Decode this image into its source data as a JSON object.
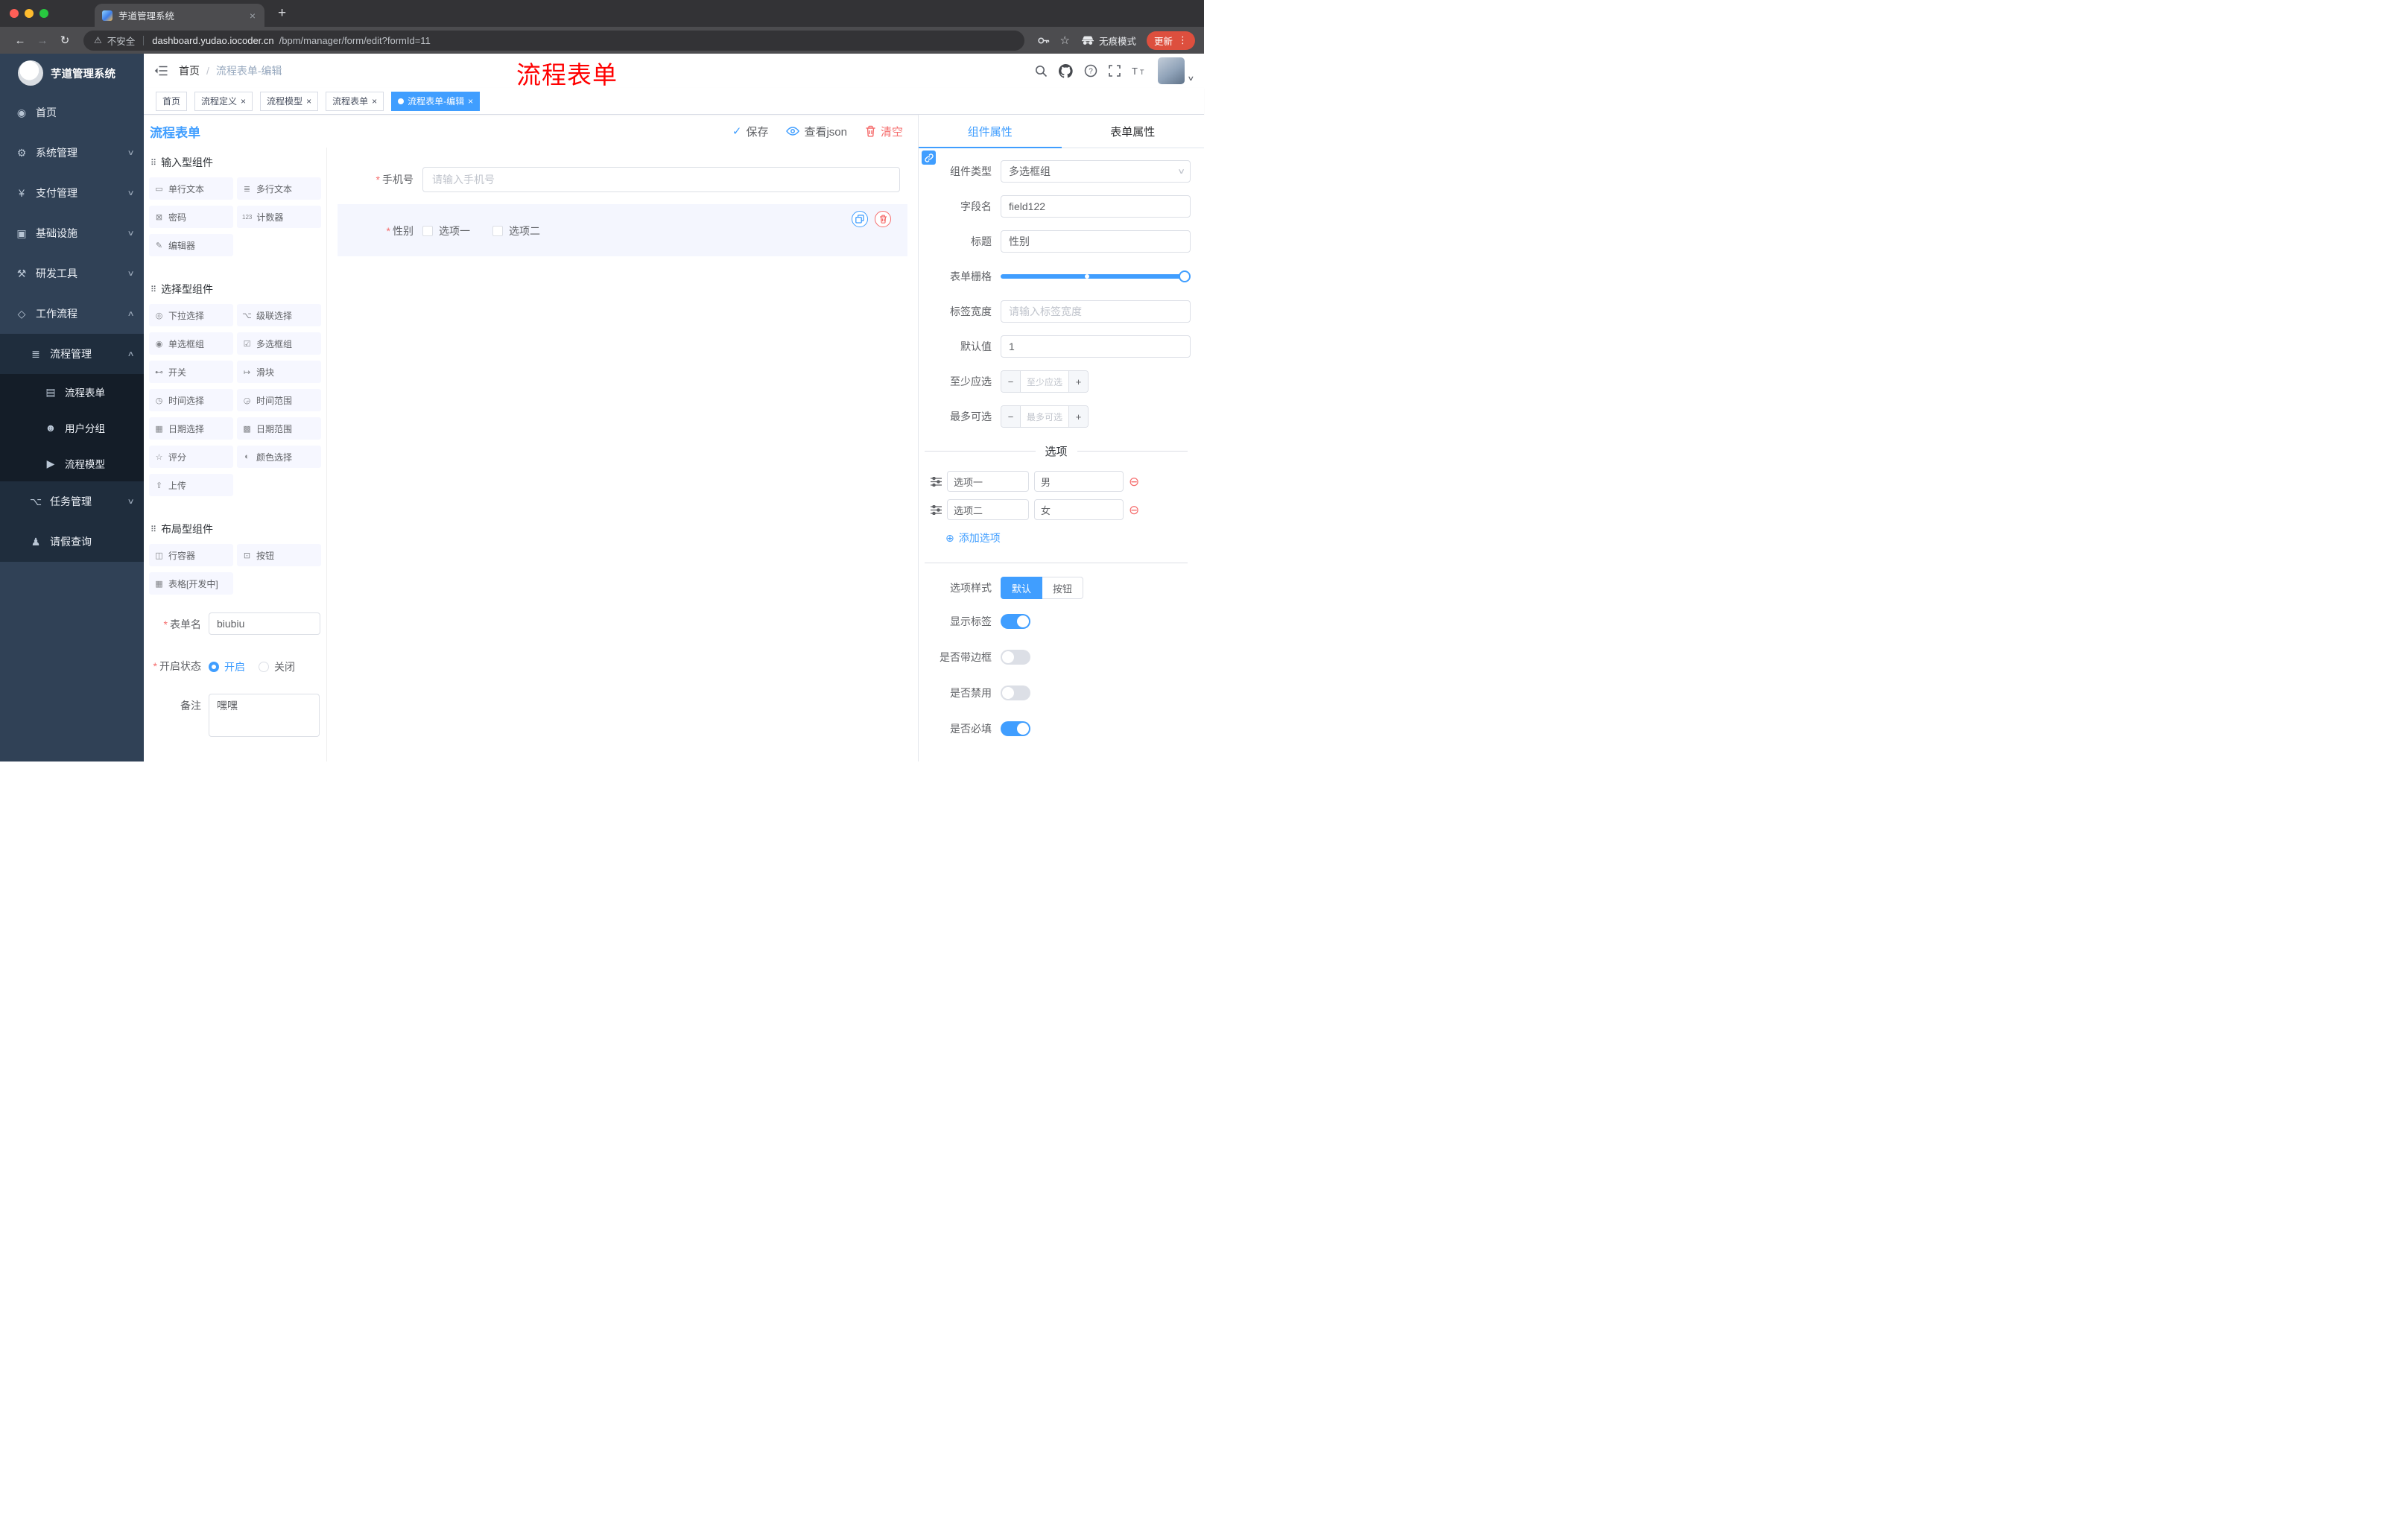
{
  "colors": {
    "accent": "#409EFF",
    "danger": "#F56C6C",
    "sidebar": "#304156"
  },
  "icons": {
    "back": "←",
    "forward": "→",
    "reload": "↻",
    "warning": "⚠",
    "star": "☆",
    "kebab": "⋮",
    "close": "×",
    "new_tab": "+",
    "check": "✓",
    "caret_down": "∨",
    "caret_up": "∧",
    "select_caret": "∨",
    "minus": "−",
    "plus": "+",
    "add_circle": "⊕",
    "remove_circle": "⊖",
    "section_drag": "⠿",
    "slash": "/",
    "required_mark": "*"
  },
  "browser": {
    "tab_title": "芋道管理系统",
    "security_label": "不安全",
    "url_domain": "dashboard.yudao.iocoder.cn",
    "url_path": "/bpm/manager/form/edit?formId=11",
    "incognito_label": "无痕模式",
    "update_label": "更新"
  },
  "sidebar": {
    "logo_title": "芋道管理系统",
    "menu": [
      {
        "label": "首页",
        "glyph": "◉"
      },
      {
        "label": "系统管理",
        "glyph": "⚙"
      },
      {
        "label": "支付管理",
        "glyph": "¥"
      },
      {
        "label": "基础设施",
        "glyph": "▣"
      },
      {
        "label": "研发工具",
        "glyph": "⚒"
      },
      {
        "label": "工作流程",
        "glyph": "◇"
      }
    ],
    "submenu": [
      {
        "label": "流程管理",
        "glyph": "≣"
      },
      {
        "label": "流程表单",
        "glyph": "▤",
        "active": true
      },
      {
        "label": "用户分组",
        "glyph": "☻"
      },
      {
        "label": "流程模型",
        "glyph": "▶"
      },
      {
        "label": "任务管理",
        "glyph": "⌥"
      },
      {
        "label": "请假查询",
        "glyph": "♟"
      }
    ]
  },
  "header": {
    "breadcrumb_home": "首页",
    "breadcrumb_current": "流程表单-编辑",
    "annotation": "流程表单"
  },
  "tags": [
    {
      "label": "首页",
      "closable": false,
      "active": false
    },
    {
      "label": "流程定义",
      "closable": true,
      "active": false
    },
    {
      "label": "流程模型",
      "closable": true,
      "active": false
    },
    {
      "label": "流程表单",
      "closable": true,
      "active": false
    },
    {
      "label": "流程表单-编辑",
      "closable": true,
      "active": true
    }
  ],
  "designer": {
    "title": "流程表单",
    "save": "保存",
    "view_json": "查看json",
    "clear": "清空"
  },
  "palette": {
    "sections": [
      {
        "title": "输入型组件"
      },
      {
        "title": "选择型组件"
      },
      {
        "title": "布局型组件"
      }
    ],
    "input_items": [
      {
        "label": "单行文本",
        "glyph": "▭"
      },
      {
        "label": "多行文本",
        "glyph": "≣"
      },
      {
        "label": "密码",
        "glyph": "⊠"
      },
      {
        "label": "计数器",
        "glyph": "123"
      },
      {
        "label": "编辑器",
        "glyph": "✎"
      }
    ],
    "select_items": [
      {
        "label": "下拉选择",
        "glyph": "◎"
      },
      {
        "label": "级联选择",
        "glyph": "⌥"
      },
      {
        "label": "单选框组",
        "glyph": "◉"
      },
      {
        "label": "多选框组",
        "glyph": "☑"
      },
      {
        "label": "开关",
        "glyph": "⊷"
      },
      {
        "label": "滑块",
        "glyph": "↦"
      },
      {
        "label": "时间选择",
        "glyph": "◷"
      },
      {
        "label": "时间范围",
        "glyph": "◶"
      },
      {
        "label": "日期选择",
        "glyph": "▦"
      },
      {
        "label": "日期范围",
        "glyph": "▩"
      },
      {
        "label": "评分",
        "glyph": "☆"
      },
      {
        "label": "颜色选择",
        "glyph": "◐"
      },
      {
        "label": "上传",
        "glyph": "⇧"
      }
    ],
    "layout_items": [
      {
        "label": "行容器",
        "glyph": "◫"
      },
      {
        "label": "按钮",
        "glyph": "⊡"
      },
      {
        "label": "表格[开发中]",
        "glyph": "▦"
      }
    ],
    "form": {
      "name_label": "表单名",
      "name_value": "biubiu",
      "status_label": "开启状态",
      "status_on": "开启",
      "status_off": "关闭",
      "status_selected": "开启",
      "remark_label": "备注",
      "remark_value": "嘿嘿"
    }
  },
  "canvas": {
    "phone_label": "手机号",
    "phone_placeholder": "请输入手机号",
    "gender_label": "性别",
    "gender_options": [
      "选项一",
      "选项二"
    ]
  },
  "props": {
    "tab_component": "组件属性",
    "tab_form": "表单属性",
    "active_tab": "组件属性",
    "component_type_label": "组件类型",
    "component_type_value": "多选框组",
    "field_name_label": "字段名",
    "field_name_value": "field122",
    "title_label": "标题",
    "title_value": "性别",
    "grid_label": "表单栅格",
    "label_width_label": "标签宽度",
    "label_width_placeholder": "请输入标签宽度",
    "default_label": "默认值",
    "default_value": "1",
    "min_label": "至少应选",
    "min_placeholder": "至少应选",
    "max_label": "最多可选",
    "max_placeholder": "最多可选",
    "options_divider": "选项",
    "options": [
      {
        "label": "选项一",
        "value": "男"
      },
      {
        "label": "选项二",
        "value": "女"
      }
    ],
    "add_option": "添加选项",
    "style_label": "选项样式",
    "style_default": "默认",
    "style_button": "按钮",
    "style_selected": "默认",
    "switches": [
      {
        "label": "显示标签",
        "on": true
      },
      {
        "label": "是否带边框",
        "on": false
      },
      {
        "label": "是否禁用",
        "on": false
      },
      {
        "label": "是否必填",
        "on": true
      }
    ]
  }
}
